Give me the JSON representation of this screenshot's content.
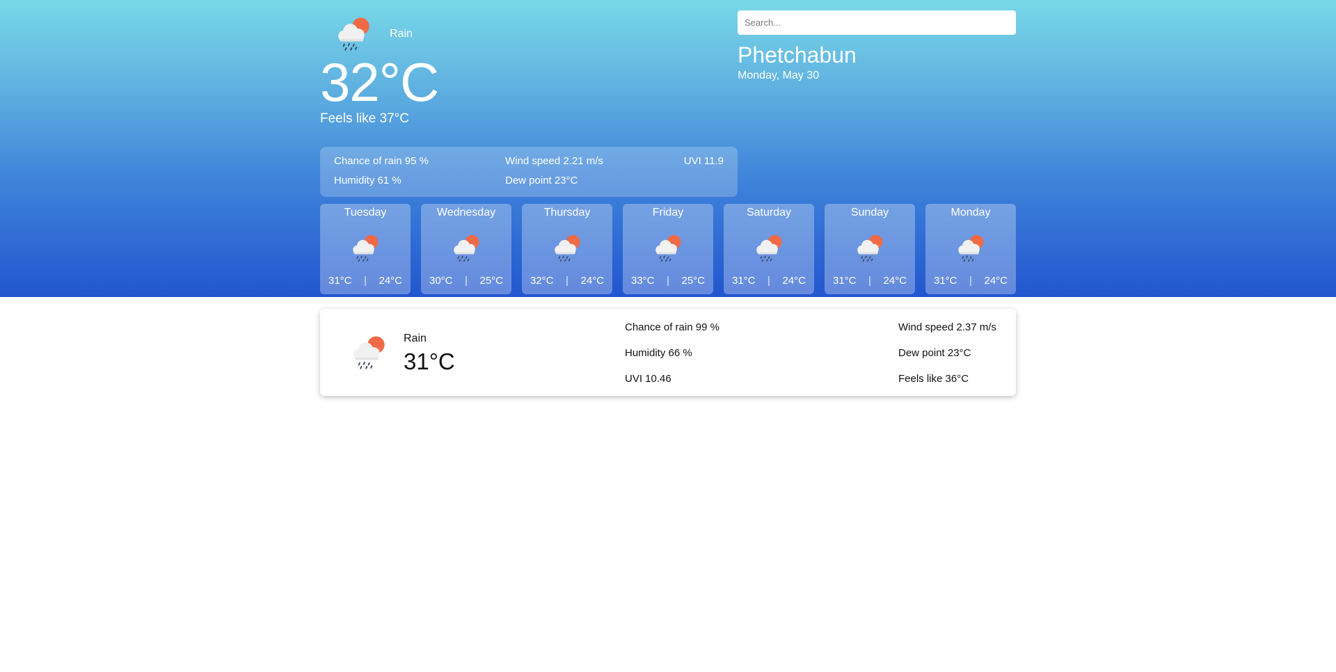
{
  "current": {
    "condition": "Rain",
    "icon": "rain-sun-icon",
    "temperature": "32°C",
    "feels_like": "Feels like 37°C"
  },
  "search": {
    "placeholder": "Search..."
  },
  "location": {
    "city": "Phetchabun",
    "date": "Monday, May 30"
  },
  "details": {
    "chance_of_rain": "Chance of rain 95 %",
    "wind_speed": "Wind speed 2.21 m/s",
    "uvi": "UVI 11.9",
    "humidity": "Humidity 61 %",
    "dew_point": "Dew point 23°C"
  },
  "forecast": [
    {
      "day": "Tuesday",
      "high": "31°C",
      "low": "24°C",
      "separator": "|",
      "icon": "rain-sun-icon"
    },
    {
      "day": "Wednesday",
      "high": "30°C",
      "low": "25°C",
      "separator": "|",
      "icon": "rain-sun-icon"
    },
    {
      "day": "Thursday",
      "high": "32°C",
      "low": "24°C",
      "separator": "|",
      "icon": "rain-sun-icon"
    },
    {
      "day": "Friday",
      "high": "33°C",
      "low": "25°C",
      "separator": "|",
      "icon": "rain-sun-icon"
    },
    {
      "day": "Saturday",
      "high": "31°C",
      "low": "24°C",
      "separator": "|",
      "icon": "rain-sun-icon"
    },
    {
      "day": "Sunday",
      "high": "31°C",
      "low": "24°C",
      "separator": "|",
      "icon": "rain-sun-icon"
    },
    {
      "day": "Monday",
      "high": "31°C",
      "low": "24°C",
      "separator": "|",
      "icon": "rain-sun-icon"
    }
  ],
  "hourly": {
    "condition": "Rain",
    "icon": "rain-sun-icon",
    "temperature": "31°C",
    "chance_of_rain": "Chance of rain 99 %",
    "humidity": "Humidity 66 %",
    "uvi": "UVI 10.46",
    "wind_speed": "Wind speed 2.37 m/s",
    "dew_point": "Dew point 23°C",
    "feels_like": "Feels like 36°C"
  },
  "colors": {
    "gradient_top": "#78d8e8",
    "gradient_bottom": "#2256cf",
    "sun": "#ef6a45",
    "cloud": "#f2f2f2",
    "rain_drops": "#3a4660"
  }
}
